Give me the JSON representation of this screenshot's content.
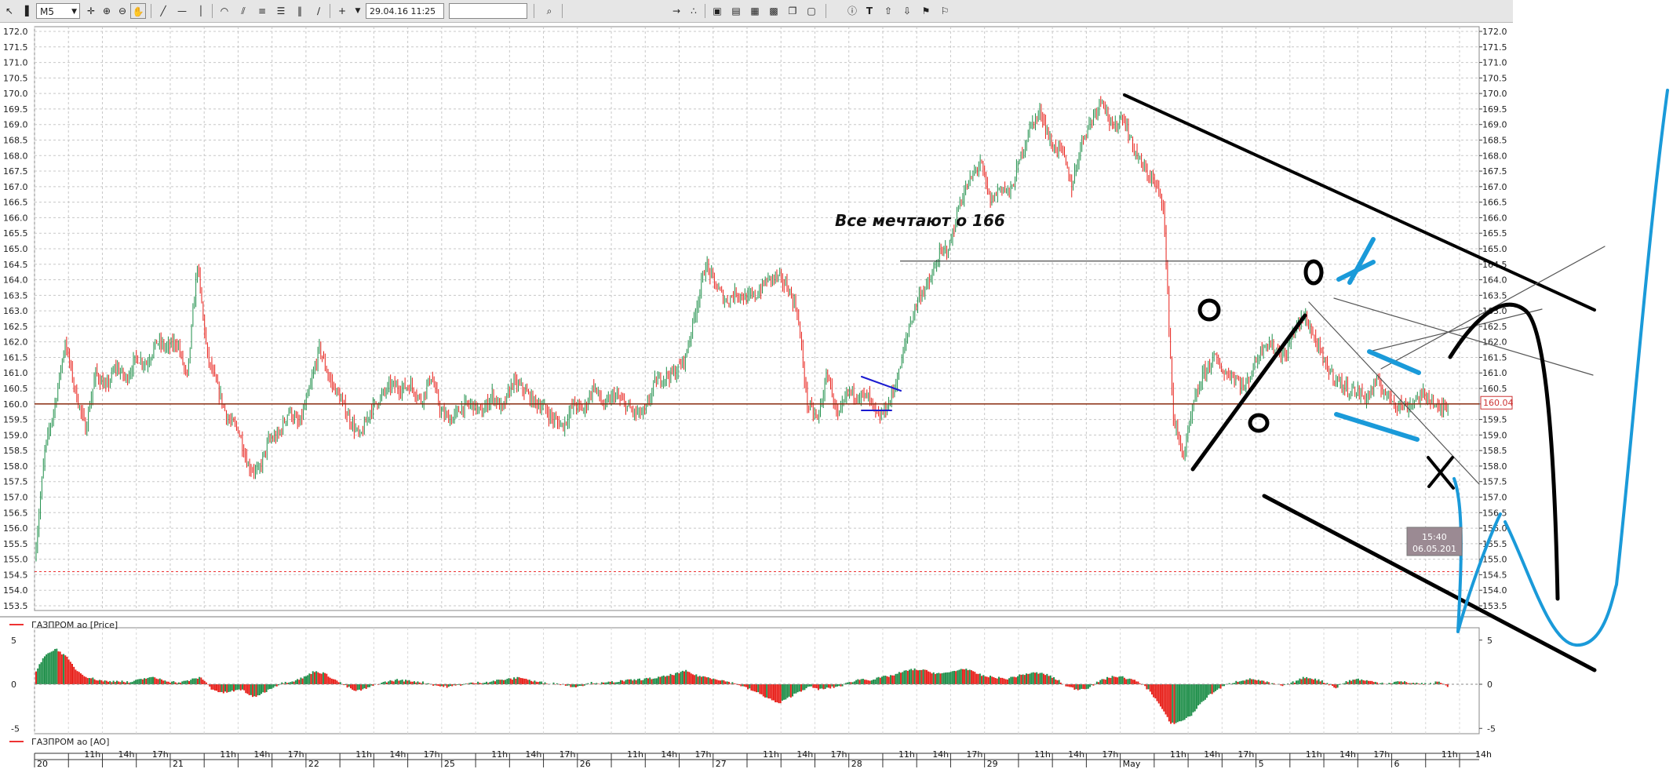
{
  "toolbar": {
    "timeframe": "M5",
    "datetime": "29.04.16 11:25",
    "icons": [
      "cursor-icon",
      "bar-chart-icon",
      "crosshair-icon",
      "zoom-in-icon",
      "zoom-out-icon",
      "hand-icon",
      "trendline-icon",
      "hline-icon",
      "vline-icon",
      "arc-icon",
      "channel-icon",
      "fibo-icon",
      "levels-icon",
      "cycles-icon",
      "pen-icon",
      "add-icon",
      "dropdown-icon",
      "search-icon",
      "tools-icon",
      "magnet-icon",
      "window-icon",
      "window2-icon",
      "table-icon",
      "watch-icon",
      "copy-icon",
      "window3-icon",
      "info-icon",
      "text-icon",
      "arrow-up-icon",
      "arrow-down-icon",
      "bell-icon"
    ]
  },
  "chart_data": [
    {
      "type": "candlestick",
      "legend": "ГАЗПРОМ ао [Price]",
      "ylim": [
        153.5,
        172.0
      ],
      "y_tick_step": 0.5,
      "last_price_label": "160.04",
      "level_line": 160.0,
      "dashed_red_level": 154.6,
      "annotation_text": "Все мечтают о      166",
      "annotation_level": 164.6,
      "cursor_time": "15:40",
      "cursor_date": "06.05.201",
      "price_path": [
        [
          0,
          155.0
        ],
        [
          1,
          158.5
        ],
        [
          2,
          160.0
        ],
        [
          3,
          162.0
        ],
        [
          4,
          160.4
        ],
        [
          5,
          159.2
        ],
        [
          6,
          161.0
        ],
        [
          7,
          160.5
        ],
        [
          8,
          161.2
        ],
        [
          9,
          160.8
        ],
        [
          10,
          161.5
        ],
        [
          11,
          161.3
        ],
        [
          12,
          162.0
        ],
        [
          13,
          161.8
        ],
        [
          14,
          162.0
        ],
        [
          15,
          160.8
        ],
        [
          16,
          164.5
        ],
        [
          17,
          161.5
        ],
        [
          18,
          160.5
        ],
        [
          19,
          159.5
        ],
        [
          20,
          159.2
        ],
        [
          21,
          158.0
        ],
        [
          22,
          157.8
        ],
        [
          23,
          158.8
        ],
        [
          24,
          159.0
        ],
        [
          25,
          159.8
        ],
        [
          26,
          159.3
        ],
        [
          27,
          160.4
        ],
        [
          28,
          161.8
        ],
        [
          29,
          160.8
        ],
        [
          30,
          160.2
        ],
        [
          31,
          159.5
        ],
        [
          32,
          158.9
        ],
        [
          33,
          159.8
        ],
        [
          34,
          160.2
        ],
        [
          35,
          160.6
        ],
        [
          36,
          160.5
        ],
        [
          37,
          160.6
        ],
        [
          38,
          160.1
        ],
        [
          39,
          160.9
        ],
        [
          40,
          159.7
        ],
        [
          41,
          159.5
        ],
        [
          42,
          159.9
        ],
        [
          43,
          160.0
        ],
        [
          44,
          159.7
        ],
        [
          45,
          160.3
        ],
        [
          46,
          159.8
        ],
        [
          47,
          160.7
        ],
        [
          48,
          160.5
        ],
        [
          49,
          160.1
        ],
        [
          50,
          159.9
        ],
        [
          51,
          159.5
        ],
        [
          52,
          159.3
        ],
        [
          53,
          160.0
        ],
        [
          54,
          159.8
        ],
        [
          55,
          160.6
        ],
        [
          56,
          159.9
        ],
        [
          57,
          160.3
        ],
        [
          58,
          160.0
        ],
        [
          59,
          159.7
        ],
        [
          60,
          159.7
        ],
        [
          61,
          160.7
        ],
        [
          62,
          160.9
        ],
        [
          63,
          161.0
        ],
        [
          64,
          161.5
        ],
        [
          65,
          163.0
        ],
        [
          66,
          164.5
        ],
        [
          67,
          163.8
        ],
        [
          68,
          163.3
        ],
        [
          69,
          163.6
        ],
        [
          70,
          163.4
        ],
        [
          71,
          163.5
        ],
        [
          72,
          164.0
        ],
        [
          73,
          164.1
        ],
        [
          74,
          163.8
        ],
        [
          75,
          163.0
        ],
        [
          76,
          160.0
        ],
        [
          77,
          159.5
        ],
        [
          78,
          161.0
        ],
        [
          79,
          159.5
        ],
        [
          80,
          160.4
        ],
        [
          81,
          160.3
        ],
        [
          82,
          160.2
        ],
        [
          83,
          159.5
        ],
        [
          84,
          160.0
        ],
        [
          85,
          161.0
        ],
        [
          86,
          162.5
        ],
        [
          87,
          163.5
        ],
        [
          88,
          163.9
        ],
        [
          89,
          164.8
        ],
        [
          90,
          165.1
        ],
        [
          91,
          166.5
        ],
        [
          92,
          167.2
        ],
        [
          93,
          167.8
        ],
        [
          94,
          166.5
        ],
        [
          95,
          167.0
        ],
        [
          96,
          166.8
        ],
        [
          97,
          168.0
        ],
        [
          98,
          169.0
        ],
        [
          99,
          169.4
        ],
        [
          100,
          168.3
        ],
        [
          101,
          168.2
        ],
        [
          102,
          167.0
        ],
        [
          103,
          168.5
        ],
        [
          104,
          169.2
        ],
        [
          105,
          169.9
        ],
        [
          106,
          168.8
        ],
        [
          107,
          169.3
        ],
        [
          108,
          168.3
        ],
        [
          109,
          167.6
        ],
        [
          110,
          167.2
        ],
        [
          111,
          166.5
        ],
        [
          112,
          159.5
        ],
        [
          113,
          158.3
        ],
        [
          114,
          160.0
        ],
        [
          115,
          161.0
        ],
        [
          116,
          161.5
        ],
        [
          117,
          161.0
        ],
        [
          118,
          160.9
        ],
        [
          119,
          160.5
        ],
        [
          120,
          161.3
        ],
        [
          121,
          162.0
        ],
        [
          122,
          161.8
        ],
        [
          123,
          161.5
        ],
        [
          124,
          162.5
        ],
        [
          125,
          162.8
        ],
        [
          126,
          162.0
        ],
        [
          127,
          161.2
        ],
        [
          128,
          160.8
        ],
        [
          129,
          160.5
        ],
        [
          130,
          160.4
        ],
        [
          131,
          160.2
        ],
        [
          132,
          160.7
        ],
        [
          133,
          160.3
        ],
        [
          134,
          160.0
        ],
        [
          135,
          159.9
        ],
        [
          136,
          160.2
        ],
        [
          137,
          160.3
        ],
        [
          138,
          159.8
        ],
        [
          139,
          160.0
        ]
      ]
    },
    {
      "type": "histogram",
      "legend": "ГАЗПРОМ ао [AO]",
      "ylim": [
        -6,
        6
      ],
      "y_ticks": [
        5,
        0,
        -5
      ],
      "values": [
        1.5,
        3.5,
        4.0,
        3.0,
        1.5,
        0.8,
        0.5,
        0.3,
        0.4,
        0.2,
        0.5,
        0.8,
        0.6,
        0.3,
        0.2,
        0.5,
        0.8,
        -0.5,
        -1.0,
        -0.8,
        -0.6,
        -1.5,
        -1.0,
        -0.3,
        0.2,
        0.4,
        0.8,
        1.5,
        1.2,
        0.5,
        -0.2,
        -0.8,
        -0.5,
        0.0,
        0.3,
        0.5,
        0.4,
        0.3,
        0.1,
        -0.2,
        -0.3,
        -0.1,
        0.1,
        0.2,
        0.3,
        0.5,
        0.6,
        0.8,
        0.4,
        0.2,
        0.1,
        0.0,
        -0.3,
        -0.1,
        0.2,
        0.1,
        0.3,
        0.4,
        0.5,
        0.6,
        0.7,
        0.9,
        1.2,
        1.5,
        1.0,
        0.8,
        0.6,
        0.3,
        0.0,
        -0.5,
        -1.0,
        -1.6,
        -2.2,
        -1.5,
        -0.8,
        -0.3,
        -0.6,
        -0.4,
        -0.2,
        0.3,
        0.6,
        0.5,
        0.8,
        1.0,
        1.4,
        1.7,
        1.6,
        1.3,
        1.2,
        1.5,
        1.8,
        1.3,
        0.9,
        0.8,
        0.6,
        0.9,
        1.2,
        1.3,
        1.1,
        0.5,
        -0.3,
        -0.6,
        -0.4,
        0.3,
        0.8,
        0.9,
        0.6,
        0.2,
        -0.8,
        -2.5,
        -4.5,
        -4.2,
        -3.5,
        -2.0,
        -1.0,
        -0.3,
        0.2,
        0.5,
        0.6,
        0.3,
        0.0,
        -0.2,
        0.3,
        0.8,
        0.6,
        0.2,
        -0.4,
        0.3,
        0.6,
        0.4,
        0.2,
        0.1,
        0.3,
        0.2,
        0.1,
        0.0,
        0.3,
        -0.4
      ]
    }
  ],
  "x_axis": {
    "date_labels": [
      {
        "i": 0,
        "t": "20"
      },
      {
        "i": 1,
        "t": "11h"
      },
      {
        "i": 2,
        "t": "14h"
      },
      {
        "i": 3,
        "t": "17h"
      },
      {
        "i": 4,
        "t": "21"
      },
      {
        "i": 5,
        "t": "11h"
      },
      {
        "i": 6,
        "t": "14h"
      },
      {
        "i": 7,
        "t": "17h"
      },
      {
        "i": 8,
        "t": "22"
      },
      {
        "i": 9,
        "t": "11h"
      },
      {
        "i": 10,
        "t": "14h"
      },
      {
        "i": 11,
        "t": "17h"
      },
      {
        "i": 12,
        "t": "25"
      },
      {
        "i": 13,
        "t": "11h"
      },
      {
        "i": 14,
        "t": "14h"
      },
      {
        "i": 15,
        "t": "17h"
      },
      {
        "i": 16,
        "t": "26"
      },
      {
        "i": 17,
        "t": "11h"
      },
      {
        "i": 18,
        "t": "14h"
      },
      {
        "i": 19,
        "t": "17h"
      },
      {
        "i": 20,
        "t": "27"
      },
      {
        "i": 21,
        "t": "11h"
      },
      {
        "i": 22,
        "t": "14h"
      },
      {
        "i": 23,
        "t": "17h"
      },
      {
        "i": 24,
        "t": "28"
      },
      {
        "i": 25,
        "t": "11h"
      },
      {
        "i": 26,
        "t": "14h"
      },
      {
        "i": 27,
        "t": "17h"
      },
      {
        "i": 28,
        "t": "29"
      },
      {
        "i": 29,
        "t": "11h"
      },
      {
        "i": 30,
        "t": "14h"
      },
      {
        "i": 31,
        "t": "17h"
      },
      {
        "i": 32,
        "t": "May"
      },
      {
        "i": 33,
        "t": "11h"
      },
      {
        "i": 34,
        "t": "14h"
      },
      {
        "i": 35,
        "t": "17h"
      },
      {
        "i": 36,
        "t": "5"
      },
      {
        "i": 37,
        "t": "11h"
      },
      {
        "i": 38,
        "t": "14h"
      },
      {
        "i": 39,
        "t": "17h"
      },
      {
        "i": 40,
        "t": "6"
      },
      {
        "i": 41,
        "t": "11h"
      },
      {
        "i": 42,
        "t": "14h"
      }
    ]
  },
  "drawings": {
    "colors": {
      "black": "#000000",
      "blue": "#1a9ad9",
      "navy": "#1a1ad0",
      "level": "#8a2c10",
      "up": "#1f8f4a",
      "down": "#e8201a"
    },
    "marks": [
      "O",
      "O",
      "O",
      "X",
      "X"
    ]
  }
}
